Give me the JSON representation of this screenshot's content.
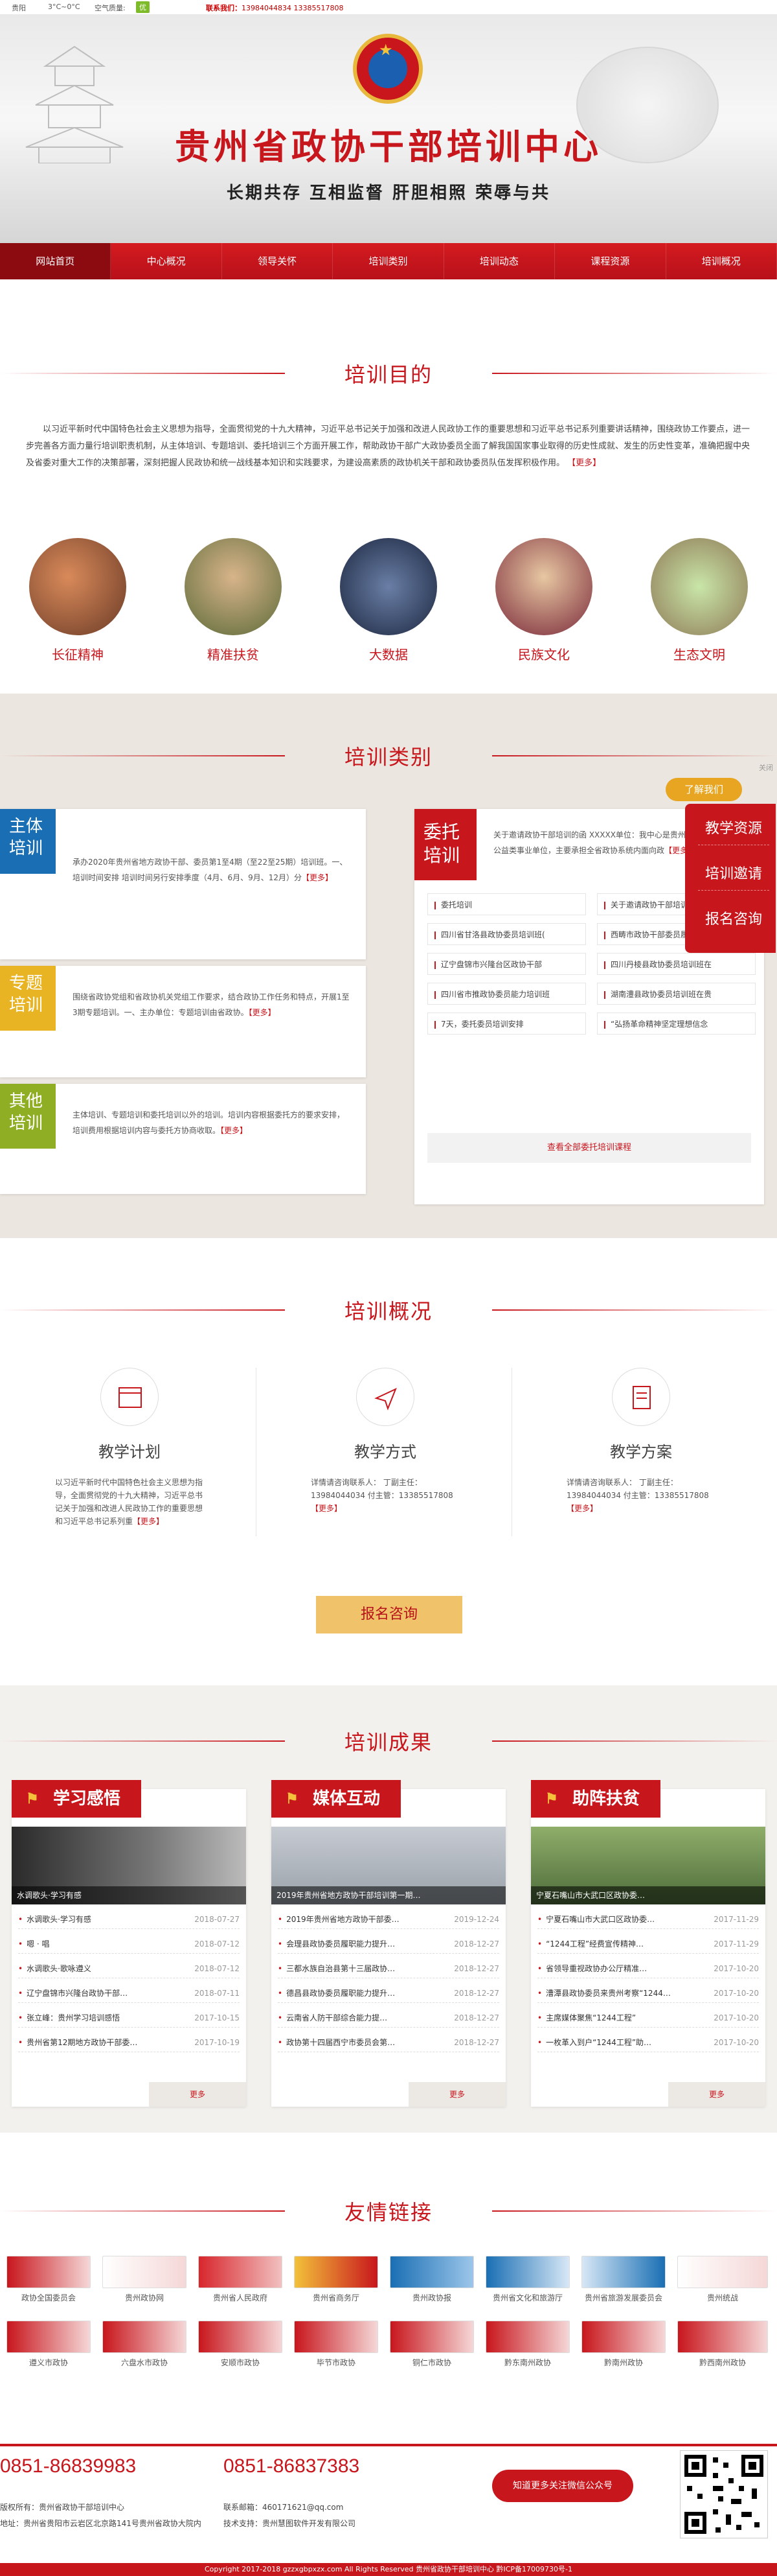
{
  "topbar": {
    "city": "贵阳",
    "weather": "3°C~0°C",
    "aq_label": "空气质量:",
    "aq_value": "优",
    "contact_label": "联系我们：",
    "contact_phones": "13984044834  13385517808"
  },
  "banner": {
    "title": "贵州省政协干部培训中心",
    "slogan": "长期共存  互相监督  肝胆相照  荣辱与共"
  },
  "nav": [
    "网站首页",
    "中心概况",
    "领导关怀",
    "培训类别",
    "培训动态",
    "课程资源",
    "培训概况"
  ],
  "purpose": {
    "heading": "培训目的",
    "text": "以习近平新时代中国特色社会主义思想为指导，全面贯彻党的十九大精神，习近平总书记关于加强和改进人民政协工作的重要思想和习近平总书记系列重要讲话精神，围绕政协工作要点，进一步完善各方面力量行培训职责机制，从主体培训、专题培训、委托培训三个方面开展工作，帮助政协干部广大政协委员全面了解我国国家事业取得的历史性成就、发生的历史性变革，准确把握中央及省委对重大工作的决策部署，深刻把握人民政协和统一战线基本知识和实践要求，为建设高素质的政协机关干部和政协委员队伍发挥积极作用。",
    "more": "【更多】"
  },
  "circles": [
    "长征精神",
    "精准扶贫",
    "大数据",
    "民族文化",
    "生态文明"
  ],
  "categories": {
    "heading": "培训类别",
    "items": [
      {
        "tag": "主体培训",
        "color": "#1a6fb4",
        "text": "承办2020年贵州省地方政协干部、委员第1至4期（至22至25期）培训班。一、培训时间安排 培训时间另行安排季度（4月、6月、9月、12月）分",
        "more": "【更多】"
      },
      {
        "tag": "专题培训",
        "color": "#e8b423",
        "text": "围绕省政协党组和省政协机关党组工作要求，结合政协工作任务和特点，开展1至3期专题培训。一、主办单位：专题培训由省政协。",
        "more": "【更多】"
      },
      {
        "tag": "其他培训",
        "color": "#8fae24",
        "text": "主体培训、专题培训和委托培训以外的培训。培训内容根据委托方的要求安排，培训费用根据培训内容与委托方协商收取。",
        "more": "【更多】"
      }
    ],
    "entrust": {
      "tag": "委托培训",
      "text": "关于邀请政协干部培训的函 XXXXX单位：我中心是贵州省政协办公厅所属公益类事业单位，主要承担全省政协系统内面向政",
      "more": "【更多】",
      "list": [
        "委托培训",
        "关于邀请政协干部培训的函",
        "四川省甘洛县政协委员培训班(",
        "西畴市政协干部委员履职能力",
        "辽宁盘锦市兴隆台区政协干部",
        "四川丹棱县政协委员培训班在",
        "四川省市推政协委员能力培训班",
        "湖南澧县政协委员培训班在贵",
        "7天，委托委员培训安排",
        "“弘扬革命精神坚定理想信念"
      ],
      "button": "查看全部委托培训课程"
    }
  },
  "float": {
    "close": "关闭",
    "header": "了解我们",
    "items": [
      "教学资源",
      "培训邀请",
      "报名咨询"
    ]
  },
  "overview": {
    "heading": "培训概况",
    "cols": [
      {
        "title": "教学计划",
        "text": "以习近平新时代中国特色社会主义思想为指导，全面贯彻党的十九大精神，习近平总书记关于加强和改进人民政协工作的重要思想和习近平总书记系列重",
        "more": "【更多】"
      },
      {
        "title": "教学方式",
        "text": "详情请咨询联系人：  丁副主任：13984044034  付主管：13385517808",
        "more": "【更多】"
      },
      {
        "title": "教学方案",
        "text": "详情请咨询联系人：  丁副主任：13984044034  付主管：13385517808",
        "more": "【更多】"
      }
    ],
    "button": "报名咨询"
  },
  "results": {
    "heading": "培训成果",
    "cols": [
      {
        "title": "学习感悟",
        "caption": "水调歌头·学习有感",
        "more": "更多",
        "rows": [
          [
            "水调歌头·学习有感",
            "2018-07-27"
          ],
          [
            "嗯 · 唱",
            "2018-07-12"
          ],
          [
            "水调歌头·歌咏遵义",
            "2018-07-12"
          ],
          [
            "辽宁盘锦市兴隆台政协干部…",
            "2018-07-11"
          ],
          [
            "张立峰：贵州学习培训感悟",
            "2017-10-15"
          ],
          [
            "贵州省第12期地方政协干部委…",
            "2017-10-19"
          ]
        ]
      },
      {
        "title": "媒体互动",
        "caption": "2019年贵州省地方政协干部培训第一期…",
        "more": "更多",
        "rows": [
          [
            "2019年贵州省地方政协干部委…",
            "2019-12-24"
          ],
          [
            "会理县政协委员履职能力提升…",
            "2018-12-27"
          ],
          [
            "三都水族自治县第十三届政协…",
            "2018-12-27"
          ],
          [
            "德昌县政协委员履职能力提升…",
            "2018-12-27"
          ],
          [
            "云南省人防干部综合能力提…",
            "2018-12-27"
          ],
          [
            "政协第十四届西宁市委员会第…",
            "2018-12-27"
          ]
        ]
      },
      {
        "title": "助阵扶贫",
        "caption": "宁夏石嘴山市大武口区政协委…",
        "more": "更多",
        "rows": [
          [
            "宁夏石嘴山市大武口区政协委…",
            "2017-11-29"
          ],
          [
            "“1244工程”经费宣传精神…",
            "2017-11-29"
          ],
          [
            "省领导重视政协办公厅精准…",
            "2017-10-20"
          ],
          [
            "漕潭县政协委员来贵州考察“1244…",
            "2017-10-20"
          ],
          [
            "主席媒体聚焦“1244工程”",
            "2017-10-20"
          ],
          [
            "一枚革入到户“1244工程”助…",
            "2017-10-20"
          ]
        ]
      }
    ]
  },
  "links": {
    "heading": "友情链接",
    "items": [
      {
        "name": "政协全国委员会",
        "color": "#c8161d"
      },
      {
        "name": "贵州政协网",
        "color": "#c8161d"
      },
      {
        "name": "贵州省人民政府",
        "color": "#d7262c"
      },
      {
        "name": "贵州省商务厅",
        "color": "#c8161d"
      },
      {
        "name": "贵州政协报",
        "color": "#1a6fb4"
      },
      {
        "name": "贵州省文化和旅游厅",
        "color": "#1a6fb4"
      },
      {
        "name": "贵州省旅游发展委员会",
        "color": "#1a6fb4"
      },
      {
        "name": "贵州统战",
        "color": "#c8161d"
      },
      {
        "name": "遵义市政协",
        "color": "#c8161d"
      },
      {
        "name": "六盘水市政协",
        "color": "#c8161d"
      },
      {
        "name": "安顺市政协",
        "color": "#c8161d"
      },
      {
        "name": "毕节市政协",
        "color": "#c8161d"
      },
      {
        "name": "铜仁市政协",
        "color": "#c8161d"
      },
      {
        "name": "黔东南州政协",
        "color": "#c8161d"
      },
      {
        "name": "黔南州政协",
        "color": "#c8161d"
      },
      {
        "name": "黔西南州政协",
        "color": "#c8161d"
      }
    ]
  },
  "footer": {
    "tel1": "0851-86839983",
    "tel2": "0851-86837383",
    "owner": "版权所有：贵州省政协干部培训中心",
    "email": "联系邮箱：460171621@qq.com",
    "address": "地址：贵州省贵阳市云岩区北京路141号贵州省政协大院内",
    "support": "技术支持：贵州慧图软件开发有限公司",
    "button": "知道更多关注微信公众号",
    "copyright": "Copyright 2017-2018 gzzxgbpxzx.com All Rights Reserved 贵州省政协干部培训中心 黔ICP备17009730号-1"
  }
}
